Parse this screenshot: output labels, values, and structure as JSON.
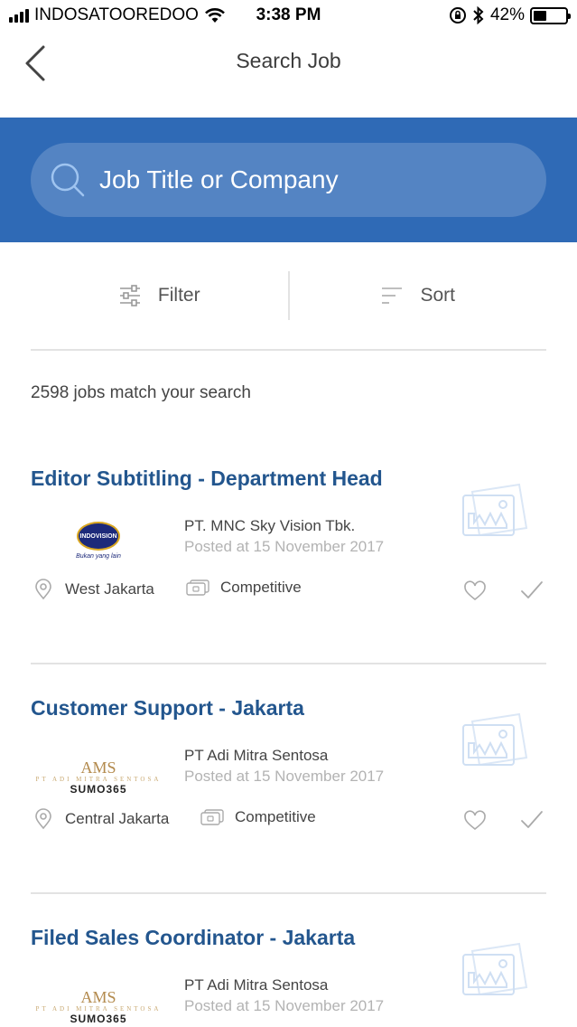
{
  "status_bar": {
    "carrier": "INDOSATOOREDOO",
    "time": "3:38 PM",
    "battery": "42%",
    "battery_level": 0.42
  },
  "nav": {
    "title": "Search Job",
    "back_icon": "chevron-left-icon"
  },
  "search": {
    "placeholder": "Job Title or Company",
    "icon": "search-icon"
  },
  "toolbar": {
    "filter_label": "Filter",
    "filter_icon": "sliders-icon",
    "sort_label": "Sort",
    "sort_icon": "sort-icon"
  },
  "results": {
    "count_text": "2598 jobs match your search"
  },
  "jobs": [
    {
      "title": "Editor Subtitling - Department Head",
      "company": "PT. MNC Sky Vision Tbk.",
      "posted": "Posted at 15 November 2017",
      "location": "West Jakarta",
      "salary": "Competitive",
      "logo": {
        "type": "indovision",
        "name": "INDOVISION",
        "tagline": "Bukan yang lain"
      }
    },
    {
      "title": "Customer Support - Jakarta",
      "company": "PT Adi Mitra Sentosa",
      "posted": "Posted at 15 November 2017",
      "location": "Central Jakarta",
      "salary": "Competitive",
      "logo": {
        "type": "ams",
        "ams": "AMS",
        "sub": "PT ADI MITRA SENTOSA",
        "brand": "SUMO365"
      }
    },
    {
      "title": "Filed Sales Coordinator - Jakarta",
      "company": "PT Adi Mitra Sentosa",
      "posted": "Posted at 15 November 2017",
      "logo": {
        "type": "ams",
        "ams": "AMS",
        "sub": "PT ADI MITRA SENTOSA",
        "brand": "SUMO365"
      }
    }
  ],
  "colors": {
    "header_blue": "#2f6ab6",
    "title_blue": "#23568e",
    "muted_gray": "#b3b3b3"
  }
}
